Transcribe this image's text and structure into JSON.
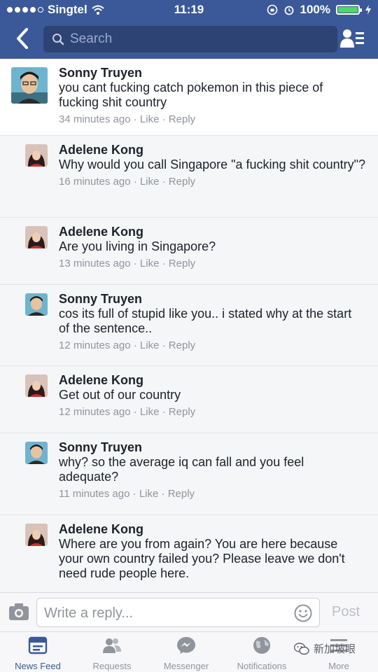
{
  "status_bar": {
    "carrier": "Singtel",
    "time": "11:19",
    "battery": "100%"
  },
  "nav": {
    "search_placeholder": "Search"
  },
  "comments": [
    {
      "author": "Sonny Truyen",
      "text": "you cant fucking catch pokemon in this piece of fucking shit country",
      "time": "34 minutes ago",
      "like": "Like",
      "reply": "Reply"
    },
    {
      "author": "Adelene Kong",
      "text": "Why would you call Singapore \"a fucking shit country\"?",
      "time": "16 minutes ago",
      "like": "Like",
      "reply": "Reply"
    },
    {
      "author": "Adelene Kong",
      "text": "Are you living in Singapore?",
      "time": "13 minutes ago",
      "like": "Like",
      "reply": "Reply"
    },
    {
      "author": "Sonny Truyen",
      "text": "cos its full of stupid like you.. i stated why at the start of the sentence..",
      "time": "12 minutes ago",
      "like": "Like",
      "reply": "Reply"
    },
    {
      "author": "Adelene Kong",
      "text": "Get out of our country",
      "time": "12 minutes ago",
      "like": "Like",
      "reply": "Reply"
    },
    {
      "author": "Sonny Truyen",
      "text": "why? so the average iq can fall and you feel adequate?",
      "time": "11 minutes ago",
      "like": "Like",
      "reply": "Reply"
    },
    {
      "author": "Adelene Kong",
      "text": "Where are you from again? You are here because your own country failed you? Please leave we don't need rude people here.",
      "time": "",
      "like": "",
      "reply": ""
    }
  ],
  "reply_bar": {
    "placeholder": "Write a reply...",
    "post_label": "Post"
  },
  "tabs": {
    "news_feed": "News Feed",
    "requests": "Requests",
    "messenger": "Messenger",
    "notifications": "Notifications",
    "more": "More"
  },
  "watermark": "新加坡眼",
  "colors": {
    "brand_blue": "#3b5998",
    "search_bg": "#2d4373",
    "meta_grey": "#90949c"
  }
}
